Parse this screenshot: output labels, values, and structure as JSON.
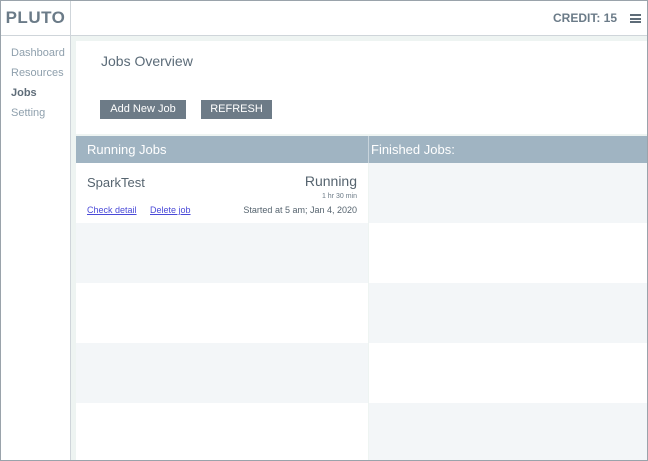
{
  "app": {
    "brand": "PLUTO",
    "credit": "CREDIT: 15",
    "menu_icon": "hamburger-menu-icon"
  },
  "sidebar": {
    "items": [
      {
        "label": "Dashboard",
        "active": false
      },
      {
        "label": "Resources",
        "active": false
      },
      {
        "label": "Jobs",
        "active": true
      },
      {
        "label": "Setting",
        "active": false
      }
    ]
  },
  "main": {
    "title": "Jobs Overview",
    "buttons": {
      "add_job": "Add New Job",
      "refresh": "REFRESH"
    },
    "table": {
      "running_header": "Running Jobs",
      "finished_header": "Finished Jobs:",
      "running_jobs": [
        {
          "name": "SparkTest",
          "status": "Running",
          "duration": "1 hr 30 min",
          "check_detail": "Check detail",
          "delete_job": "Delete job",
          "started": "Started at 5 am; Jan 4, 2020"
        }
      ],
      "finished_jobs": []
    }
  },
  "colors": {
    "brand_text": "#6b7b88",
    "header_bar": "#a0b4c2",
    "button_bg": "#6d7b87",
    "link": "#4a4ad8"
  }
}
